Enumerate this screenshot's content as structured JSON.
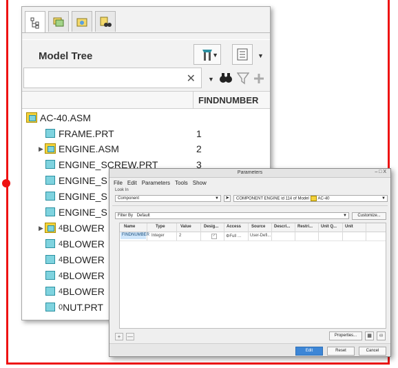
{
  "model_tree": {
    "title": "Model Tree",
    "search": {
      "value": "",
      "clear_icon": "✕"
    },
    "column_header": "FINDNUMBER",
    "rows": [
      {
        "label": "AC-40.ASM",
        "type": "asm",
        "indent": 0,
        "expander": false,
        "findnumber": ""
      },
      {
        "label": "FRAME.PRT",
        "type": "part",
        "indent": 1,
        "expander": false,
        "findnumber": "1"
      },
      {
        "label": "ENGINE.ASM",
        "type": "asm",
        "indent": 1,
        "expander": true,
        "findnumber": "2"
      },
      {
        "label": "ENGINE_SCREW.PRT",
        "type": "part",
        "indent": 1,
        "expander": false,
        "findnumber": "3"
      },
      {
        "label": "ENGINE_S",
        "type": "part",
        "indent": 1,
        "expander": false,
        "findnumber": ""
      },
      {
        "label": "ENGINE_S",
        "type": "part",
        "indent": 1,
        "expander": false,
        "findnumber": ""
      },
      {
        "label": "ENGINE_S",
        "type": "part",
        "indent": 1,
        "expander": false,
        "findnumber": ""
      },
      {
        "label": "BLOWER",
        "type": "asm",
        "indent": 1,
        "expander": true,
        "findnumber": "",
        "sub": "4"
      },
      {
        "label": "BLOWER",
        "type": "part",
        "indent": 1,
        "expander": false,
        "findnumber": "",
        "sub": "4"
      },
      {
        "label": "BLOWER",
        "type": "part",
        "indent": 1,
        "expander": false,
        "findnumber": "",
        "sub": "4"
      },
      {
        "label": "BLOWER",
        "type": "part",
        "indent": 1,
        "expander": false,
        "findnumber": "",
        "sub": "4"
      },
      {
        "label": "BLOWER",
        "type": "part",
        "indent": 1,
        "expander": false,
        "findnumber": "",
        "sub": "4"
      },
      {
        "label": "NUT.PRT",
        "type": "part",
        "indent": 1,
        "expander": false,
        "findnumber": "",
        "sub": "0"
      }
    ]
  },
  "parameters_dialog": {
    "title": "Parameters",
    "window_controls": "– □ X",
    "menu": [
      "File",
      "Edit",
      "Parameters",
      "Tools",
      "Show"
    ],
    "look_in_label": "Look In",
    "look_in_value": "Component",
    "model_value": "COMPONENT ENGINE id 114 of Model",
    "model_name": "AC-40",
    "filter_label": "Filter By",
    "filter_value": "Default",
    "customize_label": "Customize...",
    "columns": [
      "Name",
      "Type",
      "Value",
      "Desig...",
      "Access",
      "Source",
      "Descri...",
      "Restri...",
      "Unit Q...",
      "Unit"
    ],
    "rows": [
      {
        "name": "FINDNUMBER",
        "type": "Integer",
        "value": "2",
        "designated": "✓",
        "access": "Full",
        "source": "User-Defi..."
      }
    ],
    "add_label": "+",
    "remove_label": "—",
    "properties_label": "Properties...",
    "edit_label": "Edit",
    "reset_label": "Reset",
    "cancel_label": "Cancel"
  },
  "colors": {
    "frame": "#ee1111",
    "primary_button": "#3d86d6",
    "selection": "#cfe6fb"
  }
}
